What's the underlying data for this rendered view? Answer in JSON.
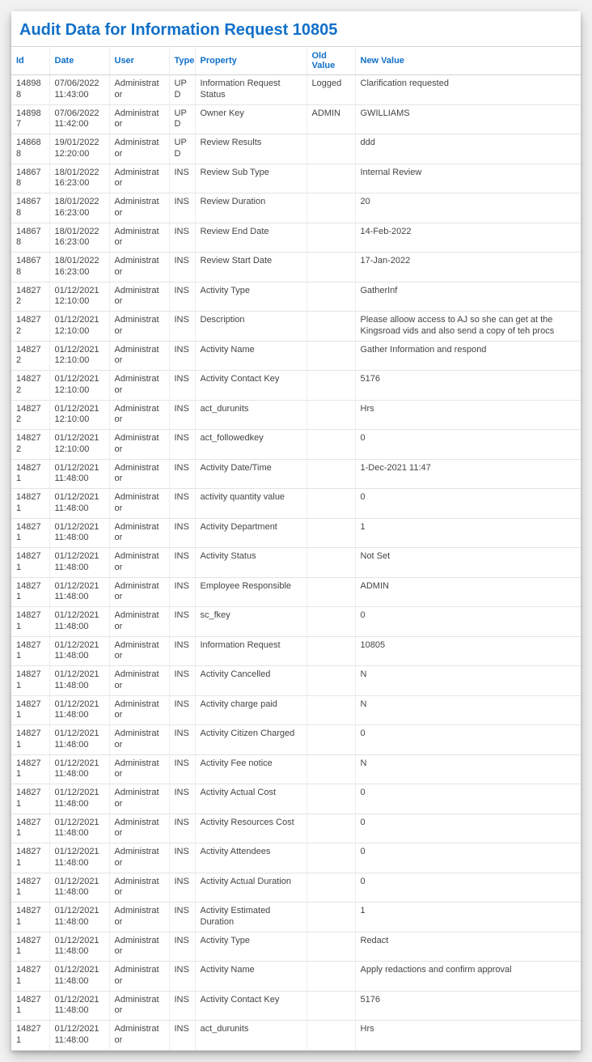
{
  "title": "Audit Data for Information Request 10805",
  "headers": {
    "id": "Id",
    "date": "Date",
    "user": "User",
    "type": "Type",
    "property": "Property",
    "old": "Old Value",
    "new": "New Value"
  },
  "rows": [
    {
      "id": "148988",
      "date": "07/06/2022 11:43:00",
      "user": "Administrator",
      "type": "UPD",
      "property": "Information Request Status",
      "old": "Logged",
      "new": "Clarification requested"
    },
    {
      "id": "148987",
      "date": "07/06/2022 11:42:00",
      "user": "Administrator",
      "type": "UPD",
      "property": "Owner Key",
      "old": "ADMIN",
      "new": "GWILLIAMS"
    },
    {
      "id": "148688",
      "date": "19/01/2022 12:20:00",
      "user": "Administrator",
      "type": "UPD",
      "property": "Review Results",
      "old": "",
      "new": "ddd"
    },
    {
      "id": "148678",
      "date": "18/01/2022 16:23:00",
      "user": "Administrator",
      "type": "INS",
      "property": "Review Sub Type",
      "old": "",
      "new": "Internal Review"
    },
    {
      "id": "148678",
      "date": "18/01/2022 16:23:00",
      "user": "Administrator",
      "type": "INS",
      "property": "Review Duration",
      "old": "",
      "new": "20"
    },
    {
      "id": "148678",
      "date": "18/01/2022 16:23:00",
      "user": "Administrator",
      "type": "INS",
      "property": "Review End Date",
      "old": "",
      "new": "14-Feb-2022"
    },
    {
      "id": "148678",
      "date": "18/01/2022 16:23:00",
      "user": "Administrator",
      "type": "INS",
      "property": "Review Start Date",
      "old": "",
      "new": "17-Jan-2022"
    },
    {
      "id": "148272",
      "date": "01/12/2021 12:10:00",
      "user": "Administrator",
      "type": "INS",
      "property": "Activity Type",
      "old": "",
      "new": "GatherInf"
    },
    {
      "id": "148272",
      "date": "01/12/2021 12:10:00",
      "user": "Administrator",
      "type": "INS",
      "property": "Description",
      "old": "",
      "new": "Please alloow access to AJ so she can get at the Kingsroad vids and also send a copy of teh procs"
    },
    {
      "id": "148272",
      "date": "01/12/2021 12:10:00",
      "user": "Administrator",
      "type": "INS",
      "property": "Activity Name",
      "old": "",
      "new": "Gather Information and respond"
    },
    {
      "id": "148272",
      "date": "01/12/2021 12:10:00",
      "user": "Administrator",
      "type": "INS",
      "property": "Activity Contact Key",
      "old": "",
      "new": "5176"
    },
    {
      "id": "148272",
      "date": "01/12/2021 12:10:00",
      "user": "Administrator",
      "type": "INS",
      "property": "act_durunits",
      "old": "",
      "new": "Hrs"
    },
    {
      "id": "148272",
      "date": "01/12/2021 12:10:00",
      "user": "Administrator",
      "type": "INS",
      "property": "act_followedkey",
      "old": "",
      "new": "0"
    },
    {
      "id": "148271",
      "date": "01/12/2021 11:48:00",
      "user": "Administrator",
      "type": "INS",
      "property": "Activity Date/Time",
      "old": "",
      "new": "1-Dec-2021 11:47"
    },
    {
      "id": "148271",
      "date": "01/12/2021 11:48:00",
      "user": "Administrator",
      "type": "INS",
      "property": "activity quantity value",
      "old": "",
      "new": "0"
    },
    {
      "id": "148271",
      "date": "01/12/2021 11:48:00",
      "user": "Administrator",
      "type": "INS",
      "property": "Activity Department",
      "old": "",
      "new": "1"
    },
    {
      "id": "148271",
      "date": "01/12/2021 11:48:00",
      "user": "Administrator",
      "type": "INS",
      "property": "Activity Status",
      "old": "",
      "new": "Not Set"
    },
    {
      "id": "148271",
      "date": "01/12/2021 11:48:00",
      "user": "Administrator",
      "type": "INS",
      "property": "Employee Responsible",
      "old": "",
      "new": "ADMIN"
    },
    {
      "id": "148271",
      "date": "01/12/2021 11:48:00",
      "user": "Administrator",
      "type": "INS",
      "property": "sc_fkey",
      "old": "",
      "new": "0"
    },
    {
      "id": "148271",
      "date": "01/12/2021 11:48:00",
      "user": "Administrator",
      "type": "INS",
      "property": "Information Request",
      "old": "",
      "new": "10805"
    },
    {
      "id": "148271",
      "date": "01/12/2021 11:48:00",
      "user": "Administrator",
      "type": "INS",
      "property": "Activity Cancelled",
      "old": "",
      "new": "N"
    },
    {
      "id": "148271",
      "date": "01/12/2021 11:48:00",
      "user": "Administrator",
      "type": "INS",
      "property": "Activity charge paid",
      "old": "",
      "new": "N"
    },
    {
      "id": "148271",
      "date": "01/12/2021 11:48:00",
      "user": "Administrator",
      "type": "INS",
      "property": "Activity Citizen Charged",
      "old": "",
      "new": "0"
    },
    {
      "id": "148271",
      "date": "01/12/2021 11:48:00",
      "user": "Administrator",
      "type": "INS",
      "property": "Activity Fee notice",
      "old": "",
      "new": "N"
    },
    {
      "id": "148271",
      "date": "01/12/2021 11:48:00",
      "user": "Administrator",
      "type": "INS",
      "property": "Activity Actual Cost",
      "old": "",
      "new": "0"
    },
    {
      "id": "148271",
      "date": "01/12/2021 11:48:00",
      "user": "Administrator",
      "type": "INS",
      "property": "Activity Resources Cost",
      "old": "",
      "new": "0"
    },
    {
      "id": "148271",
      "date": "01/12/2021 11:48:00",
      "user": "Administrator",
      "type": "INS",
      "property": "Activity Attendees",
      "old": "",
      "new": "0"
    },
    {
      "id": "148271",
      "date": "01/12/2021 11:48:00",
      "user": "Administrator",
      "type": "INS",
      "property": "Activity Actual Duration",
      "old": "",
      "new": "0"
    },
    {
      "id": "148271",
      "date": "01/12/2021 11:48:00",
      "user": "Administrator",
      "type": "INS",
      "property": "Activity Estimated Duration",
      "old": "",
      "new": "1"
    },
    {
      "id": "148271",
      "date": "01/12/2021 11:48:00",
      "user": "Administrator",
      "type": "INS",
      "property": "Activity Type",
      "old": "",
      "new": "Redact"
    },
    {
      "id": "148271",
      "date": "01/12/2021 11:48:00",
      "user": "Administrator",
      "type": "INS",
      "property": "Activity Name",
      "old": "",
      "new": "Apply redactions and confirm approval"
    },
    {
      "id": "148271",
      "date": "01/12/2021 11:48:00",
      "user": "Administrator",
      "type": "INS",
      "property": "Activity Contact Key",
      "old": "",
      "new": "5176"
    },
    {
      "id": "148271",
      "date": "01/12/2021 11:48:00",
      "user": "Administrator",
      "type": "INS",
      "property": "act_durunits",
      "old": "",
      "new": "Hrs"
    }
  ]
}
